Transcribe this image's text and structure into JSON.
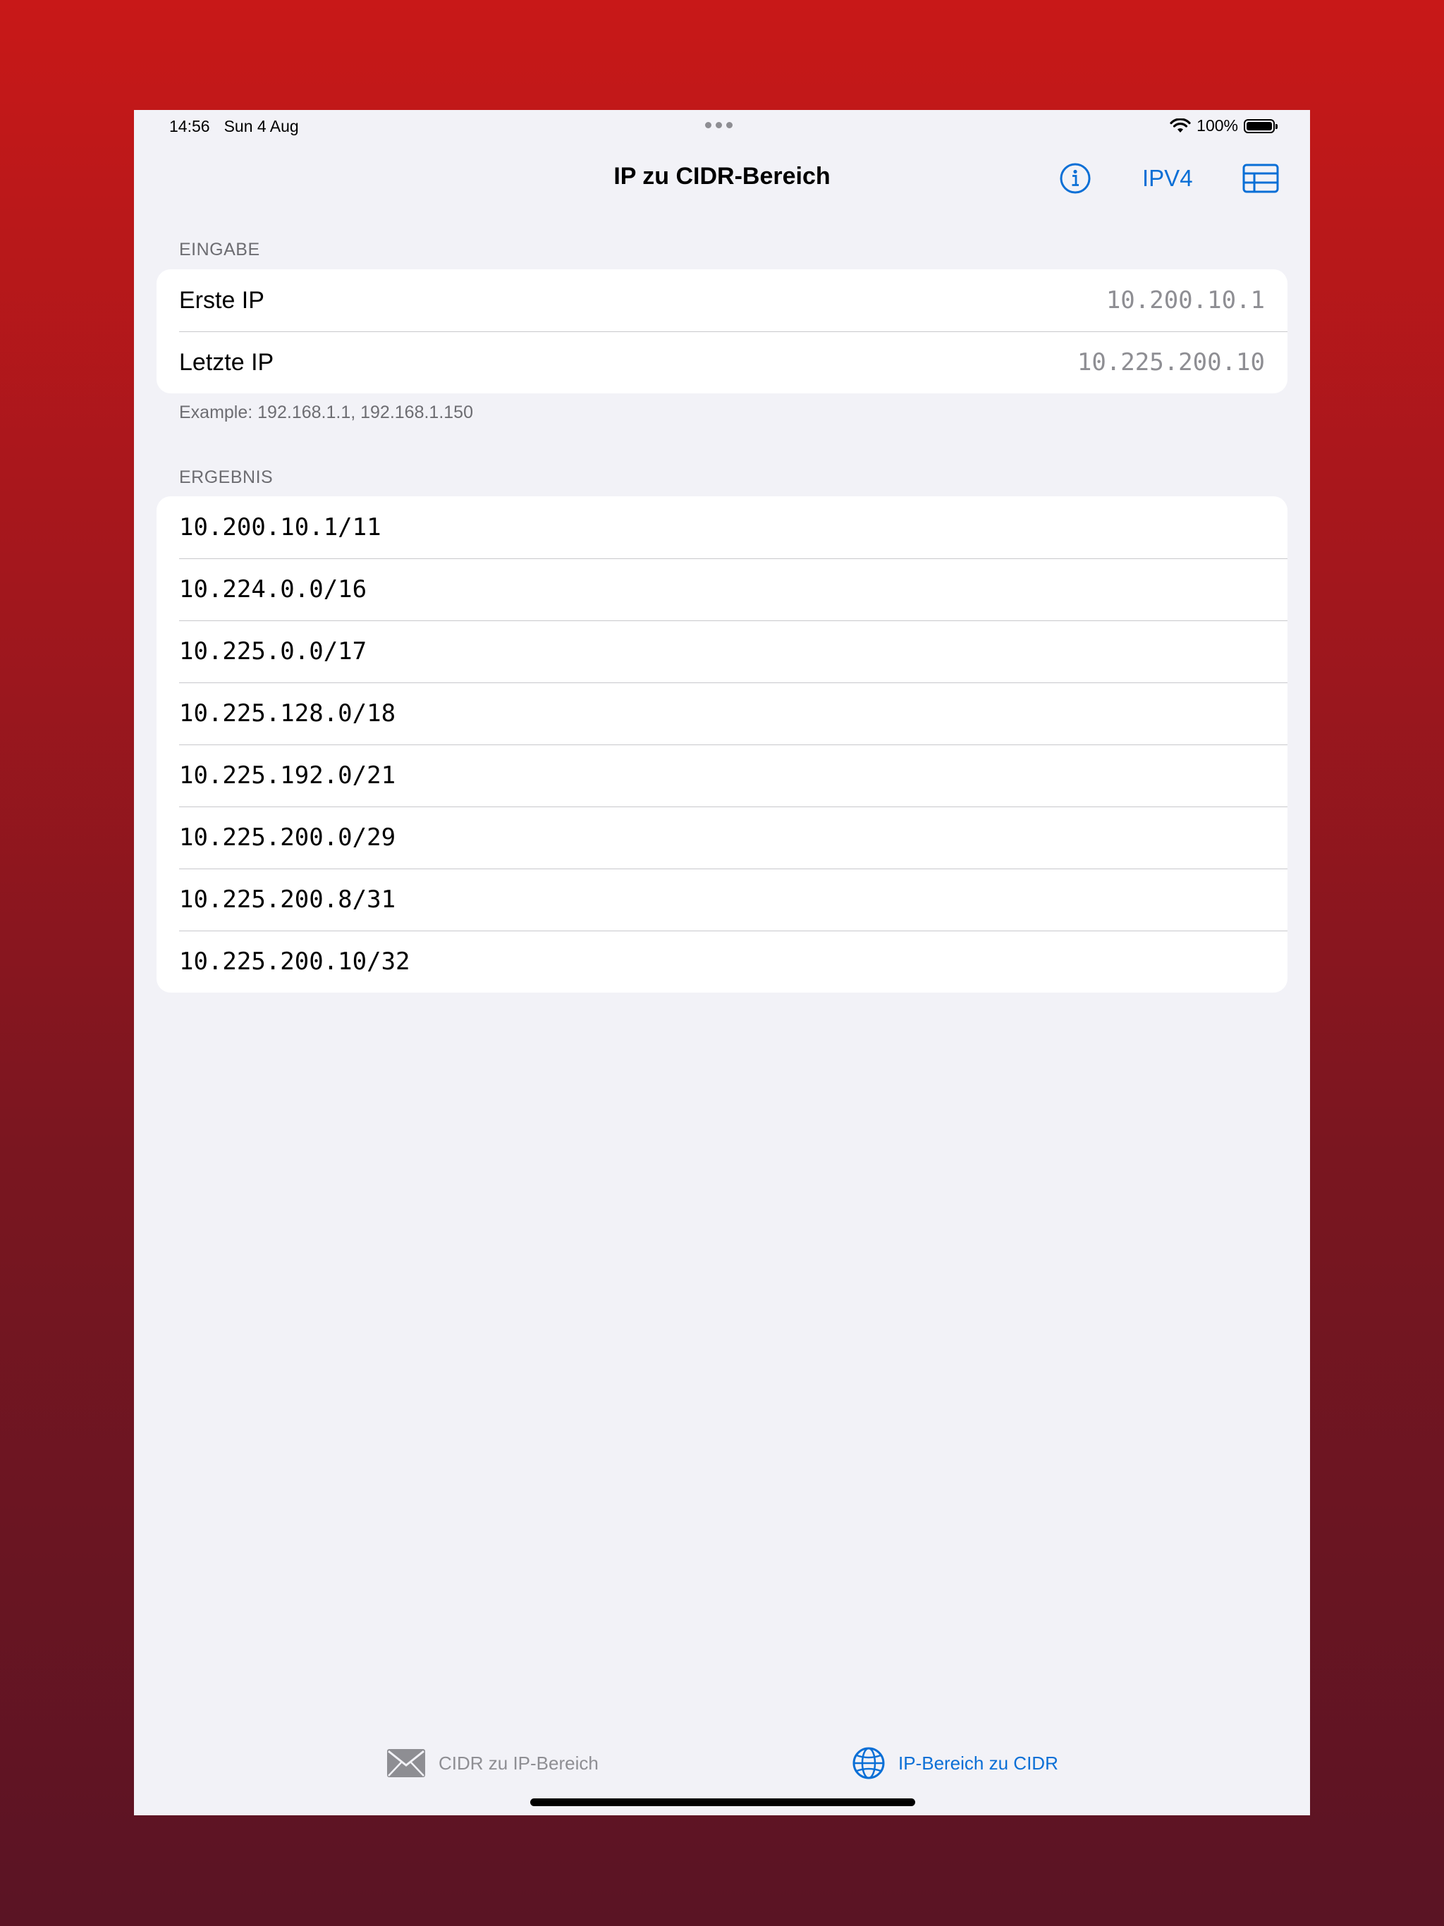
{
  "status_bar": {
    "time": "14:56",
    "date": "Sun 4 Aug",
    "battery_percent": "100%"
  },
  "nav": {
    "title": "IP zu CIDR-Bereich",
    "ipv_toggle": "IPV4"
  },
  "input_section": {
    "header": "EINGABE",
    "first_ip_label": "Erste IP",
    "first_ip_value": "10.200.10.1",
    "last_ip_label": "Letzte IP",
    "last_ip_value": "10.225.200.10",
    "example": "Example: 192.168.1.1, 192.168.1.150"
  },
  "result_section": {
    "header": "ERGEBNIS",
    "results": [
      "10.200.10.1/11",
      "10.224.0.0/16",
      "10.225.0.0/17",
      "10.225.128.0/18",
      "10.225.192.0/21",
      "10.225.200.0/29",
      "10.225.200.8/31",
      "10.225.200.10/32"
    ]
  },
  "tab_bar": {
    "tabs": [
      {
        "label": "CIDR zu IP-Bereich",
        "icon": "envelope-icon",
        "selected": false
      },
      {
        "label": "IP-Bereich zu CIDR",
        "icon": "globe-icon",
        "selected": true
      }
    ]
  },
  "colors": {
    "accent": "#0a6fd6",
    "background": "#f2f2f7",
    "inactive": "#8e8e93"
  }
}
